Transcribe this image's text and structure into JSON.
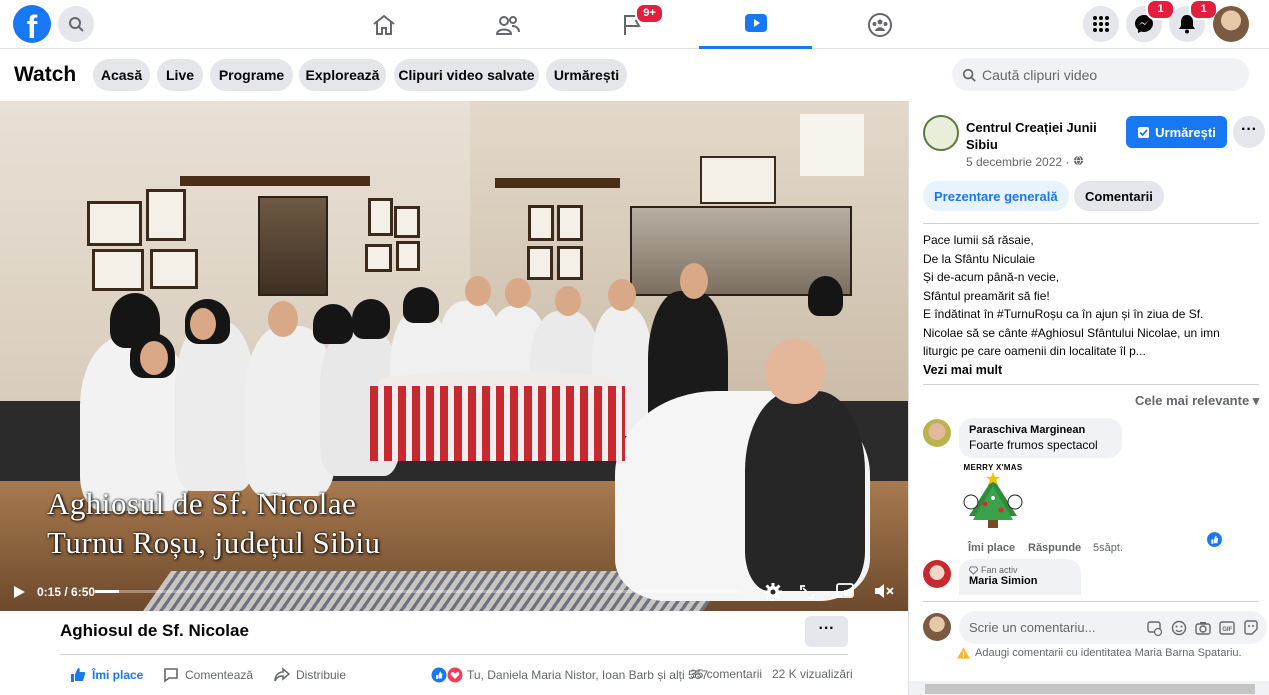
{
  "topbar": {
    "logo_letter": "f",
    "notification_badges": {
      "groups": "9+",
      "messenger": "1",
      "notifications": "1"
    },
    "nav_tabs": [
      "home-icon",
      "friends-icon",
      "pages-icon",
      "watch-icon",
      "groups-icon"
    ],
    "accent": "#1877f2"
  },
  "watch": {
    "title": "Watch",
    "pills": [
      "Acasă",
      "Live",
      "Programe",
      "Explorează",
      "Clipuri video salvate",
      "Urmărești"
    ],
    "search_placeholder": "Caută clipuri video"
  },
  "video": {
    "caption_line1": "Aghiosul de Sf. Nicolae",
    "caption_line2": "Turnu Roșu, județul Sibiu",
    "time": "0:15 / 6:50",
    "progress_fraction": 0.037
  },
  "below": {
    "title": "Aghiosul de Sf. Nicolae",
    "more": "···",
    "like": "Îmi place",
    "comment": "Comentează",
    "share": "Distribuie",
    "reactors": "Tu, Daniela Maria Nistor, Ioan Barb și alți 557",
    "comments_count": "35 comentarii",
    "views": "22 K vizualizări"
  },
  "side": {
    "page_name": "Centrul Creației Junii Sibiu",
    "date": "5 decembrie 2022 ·",
    "follow": "Urmărești",
    "more": "···",
    "tab_overview": "Prezentare generală",
    "tab_comments": "Comentarii",
    "desc_lines": [
      "Pace lumii să răsaie,",
      "De la Sfântu Niculaie",
      "Și de-acum până-n vecie,",
      "Sfântul preamărit să fie!",
      "E îndătinat în #TurnuRoșu ca în ajun și în ziua de Sf.",
      "Nicolae să se cânte #Aghiosul Sfântului Nicolae, un imn",
      "liturgic pe care oamenii din localitate îl p..."
    ],
    "see_more": "Vezi mai mult",
    "relevance": "Cele mai relevante ▾",
    "comments": [
      {
        "name": "Paraschiva Marginean",
        "text": "Foarte frumos spectacol",
        "sticker": "MERRY X'MAS",
        "like": "Îmi place",
        "reply": "Răspunde",
        "age": "5săpt."
      },
      {
        "badge": "Fan activ",
        "name": "Maria Simion"
      }
    ],
    "input_placeholder": "Scrie un comentariu...",
    "warning": "Adaugi comentarii cu identitatea Maria Barna Spatariu."
  }
}
